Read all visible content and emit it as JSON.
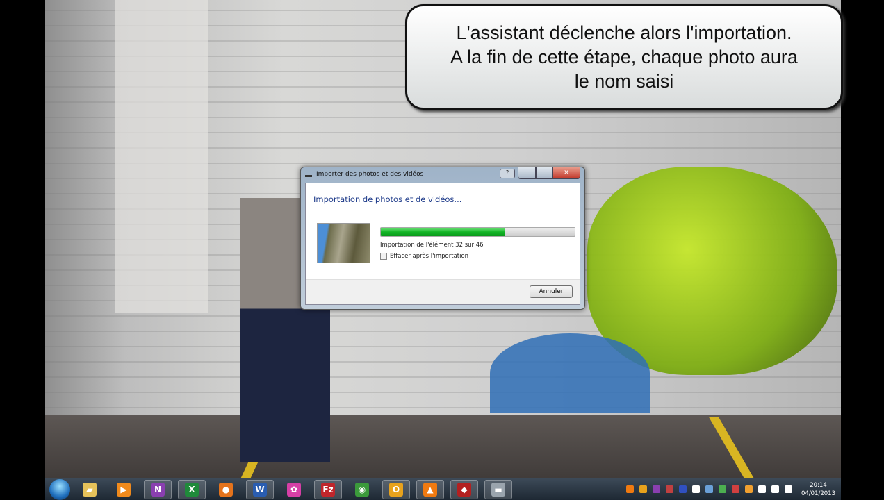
{
  "callout": {
    "lines": [
      "L'assistant déclenche alors l'importation.",
      "A la fin de cette étape, chaque photo aura",
      "le nom saisi"
    ]
  },
  "dialog": {
    "title": "Importer des photos et des vidéos",
    "heading": "Importation de photos et de vidéos...",
    "progress_fraction": 0.64,
    "status": "Importation de l'élément 32 sur 46",
    "current_item": 32,
    "total_items": 46,
    "checkbox_label": "Effacer après l'importation",
    "checkbox_checked": false,
    "cancel_label": "Annuler",
    "close_glyph": "✕"
  },
  "taskbar": {
    "apps": [
      {
        "name": "explorer",
        "glyph": "▰",
        "color": "#e6c25a"
      },
      {
        "name": "media-player",
        "glyph": "▶",
        "color": "#f08a1c"
      },
      {
        "name": "onenote",
        "glyph": "N",
        "color": "#8a3fb0"
      },
      {
        "name": "excel",
        "glyph": "X",
        "color": "#1f8a3a"
      },
      {
        "name": "firefox",
        "glyph": "●",
        "color": "#e4731c"
      },
      {
        "name": "word",
        "glyph": "W",
        "color": "#2a5db0"
      },
      {
        "name": "pink-app",
        "glyph": "✿",
        "color": "#d63fa6"
      },
      {
        "name": "filezilla",
        "glyph": "Fz",
        "color": "#c0262c"
      },
      {
        "name": "chrome",
        "glyph": "◉",
        "color": "#3b9a3b"
      },
      {
        "name": "outlook",
        "glyph": "O",
        "color": "#e8a21c"
      },
      {
        "name": "vlc",
        "glyph": "▲",
        "color": "#f07a10"
      },
      {
        "name": "red-tool",
        "glyph": "◆",
        "color": "#b32020"
      },
      {
        "name": "drive",
        "glyph": "▬",
        "color": "#9aa4ad"
      }
    ],
    "tray_colors": [
      "#f07a10",
      "#e8a21c",
      "#8a3fb0",
      "#c04040",
      "#3050c0",
      "#ffffff",
      "#6aa0d8",
      "#4caf50",
      "#d04040",
      "#f0a030",
      "#ffffff",
      "#ffffff",
      "#ffffff"
    ],
    "time": "20:14",
    "date": "04/01/2013"
  }
}
